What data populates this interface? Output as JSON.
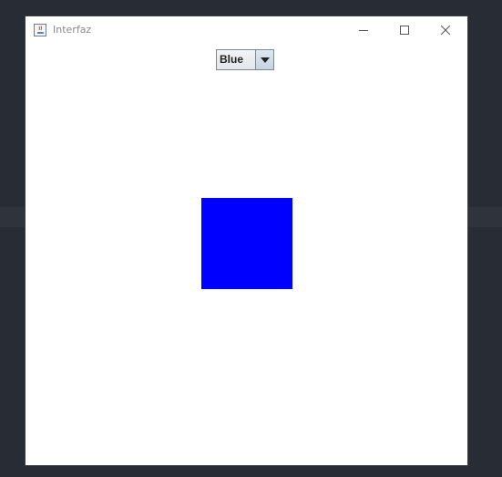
{
  "window": {
    "title": "Interfaz",
    "icon": "java-cup-icon",
    "controls": [
      "minimize-icon",
      "maximize-icon",
      "close-icon"
    ]
  },
  "combo": {
    "selected": "Blue"
  },
  "square": {
    "color": "#0000ff"
  }
}
